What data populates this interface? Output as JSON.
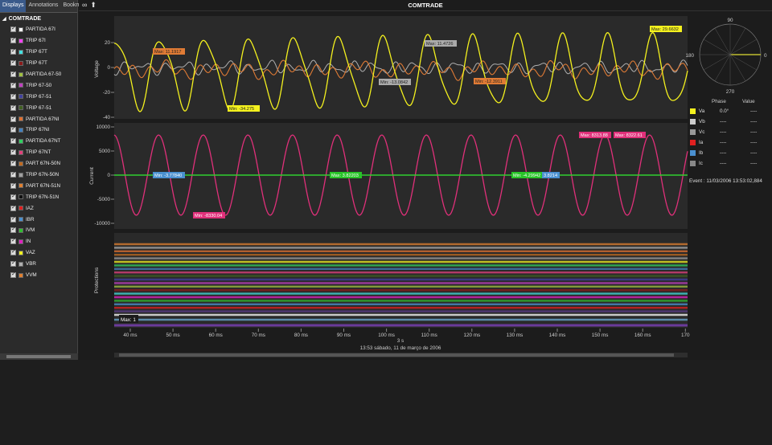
{
  "left_panel": {
    "tabs": [
      "Displays",
      "Annotations",
      "Bookmarks"
    ],
    "tree_title": "COMTRADE",
    "items": [
      {
        "label": "PARTIDA 67I",
        "color": "#ffffff"
      },
      {
        "label": "TRIP 67I",
        "color": "#ff44ff"
      },
      {
        "label": "TRIP 67T",
        "color": "#44e0e0"
      },
      {
        "label": "TRIP 67T",
        "color": "#8b1a1a"
      },
      {
        "label": "PARTIDA 67-50",
        "color": "#a0c040"
      },
      {
        "label": "TRIP 67-50",
        "color": "#c040c0"
      },
      {
        "label": "TRIP 67-51",
        "color": "#4040a0"
      },
      {
        "label": "TRIP 67-51",
        "color": "#406020"
      },
      {
        "label": "PARTIDA 67NI",
        "color": "#e07030"
      },
      {
        "label": "TRIP 67NI",
        "color": "#4080c0"
      },
      {
        "label": "PARTIDA 67NT",
        "color": "#30d060"
      },
      {
        "label": "TRIP 67NT",
        "color": "#e0407a"
      },
      {
        "label": "PART 67N-50N",
        "color": "#c06a20"
      },
      {
        "label": "TRIP 67N-50N",
        "color": "#a0a0a0"
      },
      {
        "label": "PART 67N-51N",
        "color": "#e08030"
      },
      {
        "label": "TRIP 67N-51N",
        "color": "#101010"
      },
      {
        "label": "IAZ",
        "color": "#e02020"
      },
      {
        "label": "IBR",
        "color": "#4a90d0"
      },
      {
        "label": "IVM",
        "color": "#30c030"
      },
      {
        "label": "IN",
        "color": "#e020c0"
      },
      {
        "label": "VAZ",
        "color": "#f0f020"
      },
      {
        "label": "VBR",
        "color": "#b0b0b0"
      },
      {
        "label": "VVM",
        "color": "#e08030"
      }
    ]
  },
  "header": {
    "title": "COMTRADE"
  },
  "voltage_plot": {
    "ylabel": "Voltage",
    "ticks": [
      "20",
      "0",
      "-20",
      "-40"
    ],
    "markers": [
      {
        "text": "Max: 11.1917",
        "color": "#e07b35"
      },
      {
        "text": "Min: -34.275",
        "color": "#f4f11e"
      },
      {
        "text": "Max: 11.4726",
        "color": "#aaaaaa"
      },
      {
        "text": "Min: -13.0842",
        "color": "#aaaaaa"
      },
      {
        "text": "Min: -12.3911",
        "color": "#e07b35"
      },
      {
        "text": "Max: 29.6632",
        "color": "#f4f11e"
      }
    ]
  },
  "current_plot": {
    "ylabel": "Current",
    "ticks": [
      "10000",
      "5000",
      "0",
      "-5000",
      "-10000"
    ],
    "markers": [
      {
        "text": "Min: -3.77840",
        "color": "#4a90d0"
      },
      {
        "text": "Min: -8330.04",
        "color": "#e0307a"
      },
      {
        "text": "Max: 3.82203",
        "color": "#28c428"
      },
      {
        "text": "Min: -4.29942",
        "color": "#28c428"
      },
      {
        "text": "3.8214",
        "color": "#4a90d0"
      },
      {
        "text": "Max: 8313.88",
        "color": "#e0307a"
      },
      {
        "text": "Max: 8322.61",
        "color": "#e0307a"
      }
    ]
  },
  "protections_plot": {
    "ylabel": "Protections",
    "marker": "Max: 1"
  },
  "x_axis": {
    "ticks": [
      "40 ms",
      "50 ms",
      "60 ms",
      "70 ms",
      "80 ms",
      "90 ms",
      "100 ms",
      "110 ms",
      "120 ms",
      "130 ms",
      "140 ms",
      "150 ms",
      "160 ms",
      "170"
    ],
    "center_label": "3 s",
    "timestamp": "13:53 sábado, 11 de março de 2006"
  },
  "phasor": {
    "top": "90",
    "left": "180",
    "right": "0",
    "bottom": "270"
  },
  "phase_table": {
    "headers": [
      "Phase",
      "Value"
    ],
    "rows": [
      {
        "name": "Va",
        "phase": "0.0°",
        "value": "----",
        "color": "#f4f11e"
      },
      {
        "name": "Vb",
        "phase": "----",
        "value": "----",
        "color": "#cccccc"
      },
      {
        "name": "Vc",
        "phase": "----",
        "value": "----",
        "color": "#999999"
      },
      {
        "name": "Ia",
        "phase": "----",
        "value": "----",
        "color": "#e02020"
      },
      {
        "name": "Ib",
        "phase": "----",
        "value": "----",
        "color": "#4a90d0"
      },
      {
        "name": "Ic",
        "phase": "----",
        "value": "----",
        "color": "#888888"
      }
    ]
  },
  "event": "Event : 11/03/2006 13:53:02,884"
}
